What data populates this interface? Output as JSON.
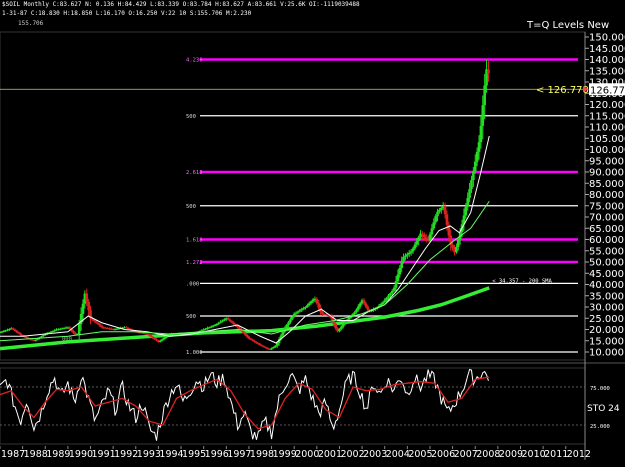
{
  "header": {
    "symbol_line": "$SOIL Monthly C:83.627 N: 0.136 H:84.429 L:83.339 O:83.784 H:83.627 A:83.661 V:25.6K OI:-1119039488",
    "ohlc_line": "1-31-87 C:18.830 H:18.850 L:16.170 O:16.250 V:22 10 S:155.706 M:2.230",
    "sub_value": "155.706"
  },
  "chart_data": {
    "type": "line",
    "title": "T=Q Levels New",
    "y_ticks": [
      "150.000",
      "145.000",
      "140.000",
      "135.000",
      "130.000",
      "125.000",
      "120.000",
      "115.000",
      "110.000",
      "105.000",
      "100.000",
      "95.000",
      "90.000",
      "85.000",
      "80.000",
      "75.000",
      "70.000",
      "65.000",
      "60.000",
      "55.000",
      "50.000",
      "45.000",
      "40.000",
      "35.000",
      "30.000",
      "25.000",
      "20.000",
      "15.000",
      "10.000"
    ],
    "ylim": [
      10,
      150
    ],
    "x_ticks": [
      "1987",
      "1988",
      "1989",
      "1990",
      "1991",
      "1992",
      "1993",
      "1994",
      "1995",
      "1996",
      "1997",
      "1998",
      "1999",
      "2000",
      "2001",
      "2002",
      "2003",
      "2004",
      "2005",
      "2006",
      "2007",
      "2008",
      "2009",
      "2010",
      "2011",
      "2012"
    ],
    "current_price": 126.77,
    "current_price_label": "126.770",
    "current_price_marker": "< 126.770",
    "price_approx": [
      [
        1987.0,
        18.8
      ],
      [
        1987.5,
        20.5
      ],
      [
        1988.0,
        17
      ],
      [
        1988.5,
        15
      ],
      [
        1989.0,
        18
      ],
      [
        1989.5,
        20
      ],
      [
        1990.0,
        21
      ],
      [
        1990.4,
        17
      ],
      [
        1990.75,
        36
      ],
      [
        1991.0,
        25
      ],
      [
        1991.5,
        21
      ],
      [
        1992.0,
        20
      ],
      [
        1992.5,
        21
      ],
      [
        1993.0,
        19
      ],
      [
        1993.5,
        18
      ],
      [
        1994.0,
        14.5
      ],
      [
        1994.5,
        18
      ],
      [
        1995.0,
        18
      ],
      [
        1995.5,
        18
      ],
      [
        1996.0,
        20
      ],
      [
        1996.5,
        22
      ],
      [
        1997.0,
        25
      ],
      [
        1997.5,
        21
      ],
      [
        1998.0,
        16
      ],
      [
        1998.5,
        13
      ],
      [
        1998.9,
        11
      ],
      [
        1999.2,
        13
      ],
      [
        1999.6,
        21
      ],
      [
        2000.0,
        27
      ],
      [
        2000.5,
        30
      ],
      [
        2000.9,
        34
      ],
      [
        2001.2,
        27
      ],
      [
        2001.6,
        26
      ],
      [
        2001.9,
        19
      ],
      [
        2002.3,
        24
      ],
      [
        2002.7,
        28
      ],
      [
        2003.0,
        33
      ],
      [
        2003.3,
        28
      ],
      [
        2003.7,
        30
      ],
      [
        2004.0,
        33
      ],
      [
        2004.4,
        38
      ],
      [
        2004.8,
        52
      ],
      [
        2005.2,
        55
      ],
      [
        2005.6,
        63
      ],
      [
        2005.9,
        59
      ],
      [
        2006.3,
        72
      ],
      [
        2006.6,
        75
      ],
      [
        2006.9,
        58
      ],
      [
        2007.1,
        54
      ],
      [
        2007.4,
        66
      ],
      [
        2007.7,
        80
      ],
      [
        2007.95,
        92
      ],
      [
        2008.2,
        105
      ],
      [
        2008.4,
        127
      ],
      [
        2008.55,
        140
      ],
      [
        2008.62,
        126.77
      ]
    ],
    "ma_fast_approx": [
      [
        1987.0,
        17
      ],
      [
        1988.0,
        17
      ],
      [
        1989.0,
        18
      ],
      [
        1990.0,
        19
      ],
      [
        1990.9,
        26
      ],
      [
        1991.5,
        23
      ],
      [
        1992.5,
        20
      ],
      [
        1993.5,
        19
      ],
      [
        1994.5,
        17
      ],
      [
        1995.5,
        18
      ],
      [
        1996.5,
        20
      ],
      [
        1997.5,
        22
      ],
      [
        1998.5,
        17
      ],
      [
        1999.2,
        14
      ],
      [
        1999.8,
        19
      ],
      [
        2000.5,
        26
      ],
      [
        2001.2,
        29
      ],
      [
        2001.9,
        24
      ],
      [
        2002.6,
        24
      ],
      [
        2003.3,
        28
      ],
      [
        2004.0,
        31
      ],
      [
        2004.6,
        38
      ],
      [
        2005.2,
        47
      ],
      [
        2005.8,
        56
      ],
      [
        2006.4,
        64
      ],
      [
        2006.9,
        66
      ],
      [
        2007.3,
        63
      ],
      [
        2007.8,
        72
      ],
      [
        2008.2,
        88
      ],
      [
        2008.62,
        106
      ]
    ],
    "ma_slow_approx": [
      [
        1987.0,
        15
      ],
      [
        1988.5,
        16
      ],
      [
        1990.0,
        17
      ],
      [
        1991.5,
        19
      ],
      [
        1993.0,
        19
      ],
      [
        1994.5,
        18
      ],
      [
        1996.0,
        19
      ],
      [
        1997.5,
        20
      ],
      [
        1999.0,
        18
      ],
      [
        2000.5,
        22
      ],
      [
        2001.8,
        24
      ],
      [
        2003.0,
        27
      ],
      [
        2004.0,
        31
      ],
      [
        2005.0,
        40
      ],
      [
        2006.0,
        51
      ],
      [
        2007.0,
        59
      ],
      [
        2007.8,
        65
      ],
      [
        2008.62,
        77
      ]
    ],
    "sma200_approx": [
      [
        1987.0,
        11.5
      ],
      [
        1990.0,
        14.5
      ],
      [
        1993.0,
        16.5
      ],
      [
        1996.0,
        18.5
      ],
      [
        1999.0,
        19.5
      ],
      [
        2001.0,
        21.5
      ],
      [
        2002.5,
        23.5
      ],
      [
        2004.0,
        25.5
      ],
      [
        2005.5,
        28.5
      ],
      [
        2006.5,
        31
      ],
      [
        2007.5,
        34.5
      ],
      [
        2008.2,
        37
      ],
      [
        2008.62,
        38.5
      ]
    ],
    "sma200_label": "< 34.357 - 200 SMA",
    "levels": [
      {
        "value": 140,
        "label": "4.236",
        "color": "#ff00ff"
      },
      {
        "value": 115,
        "label": "500",
        "color": "#ffffff"
      },
      {
        "value": 90,
        "label": "2.618",
        "color": "#ff00ff"
      },
      {
        "value": 75,
        "label": "500",
        "color": "#ffffff"
      },
      {
        "value": 60,
        "label": "1.618",
        "color": "#ff00ff"
      },
      {
        "value": 50,
        "label": "1.272",
        "color": "#ff00ff"
      },
      {
        "value": 40.5,
        "label": ".000",
        "color": "#ffffff"
      },
      {
        "value": 26,
        "label": "500",
        "color": "#ffffff"
      },
      {
        "value": 10,
        "label": "1.000",
        "color": "#ffffff"
      }
    ],
    "low_label": "000",
    "ref_line_value": 126.77,
    "stochastic": {
      "label": "STO",
      "period": "24",
      "levels": [
        "75.000",
        "25.000"
      ],
      "k_approx": [
        [
          1987.0,
          72
        ],
        [
          1987.3,
          85
        ],
        [
          1987.6,
          55
        ],
        [
          1987.9,
          30
        ],
        [
          1988.2,
          60
        ],
        [
          1988.5,
          22
        ],
        [
          1988.8,
          40
        ],
        [
          1989.1,
          70
        ],
        [
          1989.4,
          88
        ],
        [
          1989.7,
          62
        ],
        [
          1990.0,
          80
        ],
        [
          1990.3,
          55
        ],
        [
          1990.6,
          92
        ],
        [
          1990.9,
          60
        ],
        [
          1991.2,
          30
        ],
        [
          1991.5,
          50
        ],
        [
          1991.8,
          70
        ],
        [
          1992.1,
          45
        ],
        [
          1992.4,
          75
        ],
        [
          1992.7,
          50
        ],
        [
          1993.0,
          35
        ],
        [
          1993.3,
          55
        ],
        [
          1993.6,
          20
        ],
        [
          1993.9,
          10
        ],
        [
          1994.2,
          40
        ],
        [
          1994.5,
          65
        ],
        [
          1994.8,
          80
        ],
        [
          1995.1,
          55
        ],
        [
          1995.4,
          70
        ],
        [
          1995.7,
          85
        ],
        [
          1996.0,
          75
        ],
        [
          1996.3,
          92
        ],
        [
          1996.6,
          80
        ],
        [
          1996.9,
          88
        ],
        [
          1997.2,
          55
        ],
        [
          1997.5,
          25
        ],
        [
          1997.8,
          40
        ],
        [
          1998.1,
          15
        ],
        [
          1998.4,
          8
        ],
        [
          1998.7,
          30
        ],
        [
          1999.0,
          15
        ],
        [
          1999.3,
          55
        ],
        [
          1999.6,
          80
        ],
        [
          1999.9,
          90
        ],
        [
          2000.2,
          70
        ],
        [
          2000.5,
          85
        ],
        [
          2000.8,
          60
        ],
        [
          2001.1,
          40
        ],
        [
          2001.4,
          55
        ],
        [
          2001.7,
          20
        ],
        [
          2002.0,
          45
        ],
        [
          2002.3,
          80
        ],
        [
          2002.6,
          90
        ],
        [
          2002.9,
          70
        ],
        [
          2003.2,
          45
        ],
        [
          2003.5,
          80
        ],
        [
          2003.8,
          65
        ],
        [
          2004.1,
          85
        ],
        [
          2004.4,
          70
        ],
        [
          2004.7,
          90
        ],
        [
          2005.0,
          65
        ],
        [
          2005.3,
          88
        ],
        [
          2005.6,
          75
        ],
        [
          2005.9,
          90
        ],
        [
          2006.2,
          85
        ],
        [
          2006.5,
          60
        ],
        [
          2006.8,
          40
        ],
        [
          2007.1,
          55
        ],
        [
          2007.4,
          70
        ],
        [
          2007.7,
          92
        ],
        [
          2008.0,
          85
        ],
        [
          2008.3,
          95
        ],
        [
          2008.62,
          88
        ]
      ],
      "d_approx": [
        [
          1987.0,
          65
        ],
        [
          1987.5,
          70
        ],
        [
          1988.0,
          50
        ],
        [
          1988.5,
          35
        ],
        [
          1989.0,
          55
        ],
        [
          1989.5,
          72
        ],
        [
          1990.0,
          70
        ],
        [
          1990.6,
          75
        ],
        [
          1991.2,
          50
        ],
        [
          1991.8,
          55
        ],
        [
          1992.4,
          60
        ],
        [
          1993.0,
          50
        ],
        [
          1993.6,
          30
        ],
        [
          1994.2,
          25
        ],
        [
          1994.8,
          60
        ],
        [
          1995.4,
          70
        ],
        [
          1996.0,
          78
        ],
        [
          1996.6,
          85
        ],
        [
          1997.2,
          70
        ],
        [
          1997.8,
          40
        ],
        [
          1998.4,
          20
        ],
        [
          1999.0,
          25
        ],
        [
          1999.6,
          60
        ],
        [
          2000.2,
          80
        ],
        [
          2000.8,
          72
        ],
        [
          2001.4,
          45
        ],
        [
          2002.0,
          35
        ],
        [
          2002.6,
          75
        ],
        [
          2003.2,
          70
        ],
        [
          2003.8,
          72
        ],
        [
          2004.4,
          78
        ],
        [
          2005.0,
          80
        ],
        [
          2005.6,
          82
        ],
        [
          2006.2,
          80
        ],
        [
          2006.8,
          55
        ],
        [
          2007.4,
          60
        ],
        [
          2008.0,
          85
        ],
        [
          2008.62,
          88
        ]
      ]
    }
  },
  "colors": {
    "background": "#000000",
    "price_up": "#22dd22",
    "price_down": "#dd2222",
    "level_magenta": "#ff00ff",
    "sma200": "#33ee33",
    "ma_fast": "#ffffff",
    "ma_slow": "#66ff66",
    "ref_line": "#cccc66",
    "sto_k": "#ffffff",
    "sto_d": "#dd2222"
  }
}
